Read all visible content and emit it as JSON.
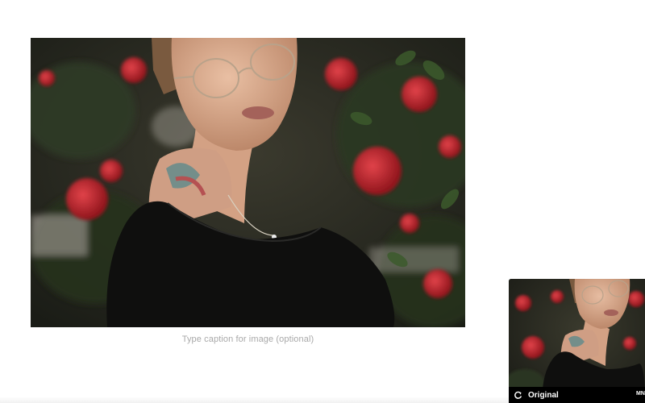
{
  "editor": {
    "caption_placeholder": "Type caption for image (optional)"
  },
  "filter_preview": {
    "reset_icon": "rotate-icon",
    "current_filter": "Original",
    "next_chip_label": "MN"
  },
  "colors": {
    "caption": "#a9a9a9",
    "filter_bar_bg": "#000000",
    "rose_red": "#c3262b",
    "foliage": "#2f3a25"
  }
}
